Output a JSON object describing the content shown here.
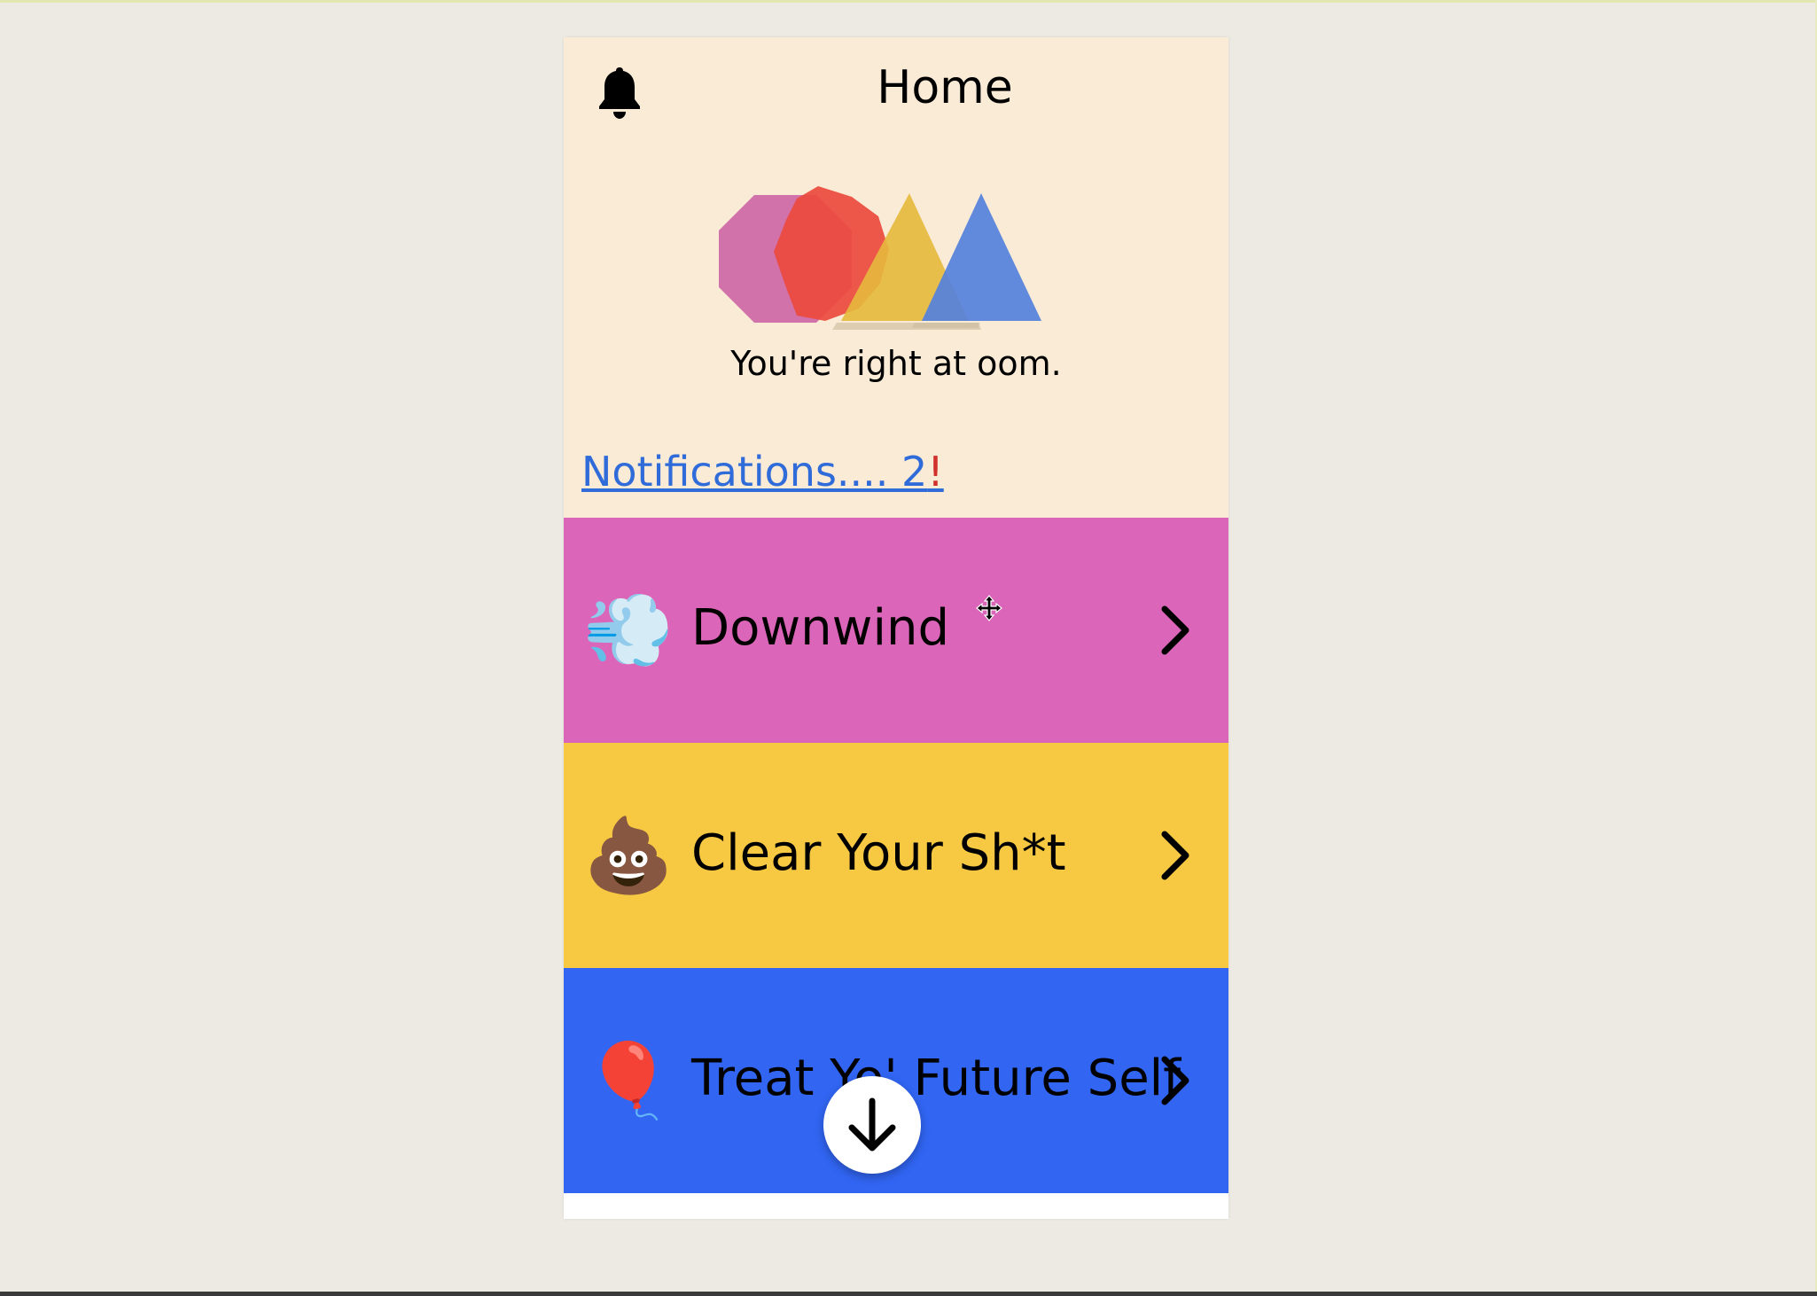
{
  "header": {
    "title": "Home",
    "bell_icon": "bell-icon"
  },
  "hero": {
    "logo_icon": "colorful-shapes-logo",
    "tagline": "You're right at oom."
  },
  "notifications": {
    "label": "Notifications.... 2",
    "bang": "!",
    "link_color": "#2f6bd9"
  },
  "rows": [
    {
      "label": "Downwind",
      "emoji": "💨",
      "icon": "wind-icon",
      "color": "#db65b8"
    },
    {
      "label": "Clear Your Sh*t",
      "emoji": "💩",
      "icon": "poop-icon",
      "color": "#f7c842"
    },
    {
      "label": "Treat Yo' Future Self",
      "emoji": "🎈",
      "icon": "balloon-icon",
      "color": "#3165f2"
    }
  ],
  "fab": {
    "icon": "arrow-down-icon"
  },
  "colors": {
    "page_bg": "#edeae3",
    "panel_bg": "#faebd7"
  }
}
